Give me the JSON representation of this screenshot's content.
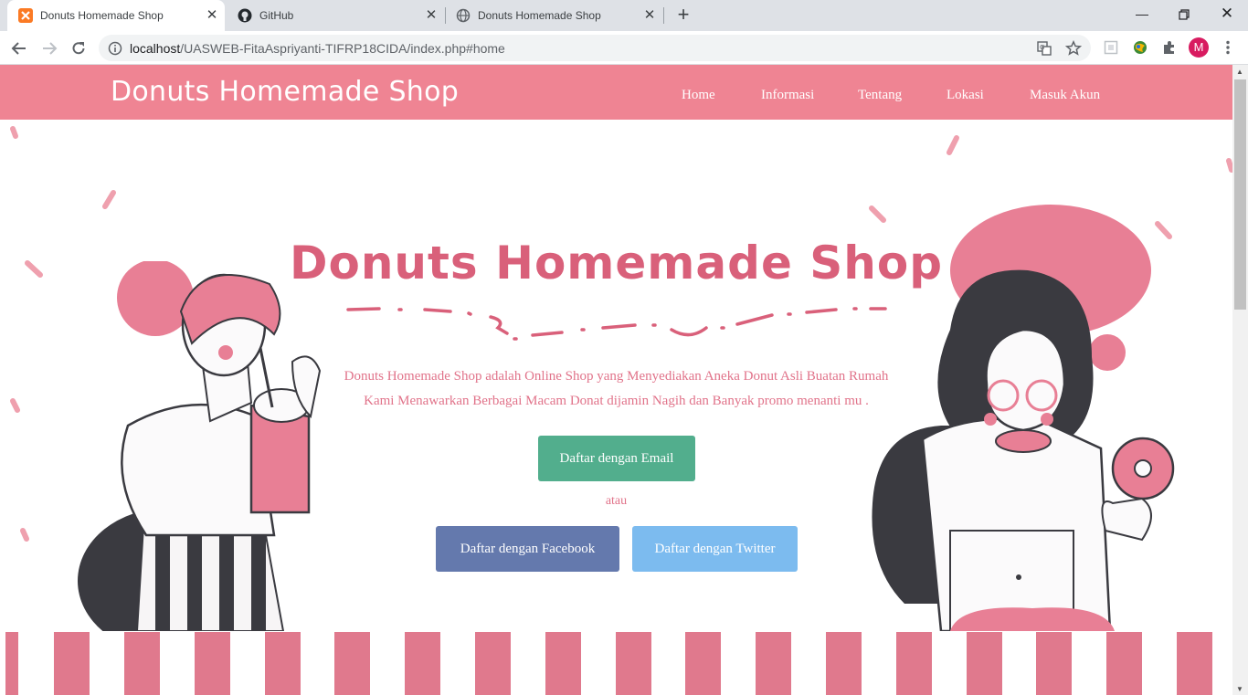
{
  "browser": {
    "tabs": [
      {
        "title": "Donuts Homemade Shop",
        "active": true,
        "icon": "xampp-icon"
      },
      {
        "title": "GitHub",
        "active": false,
        "icon": "github-icon"
      },
      {
        "title": "Donuts Homemade Shop",
        "active": false,
        "icon": "globe-icon"
      }
    ],
    "new_tab": "+",
    "url_host": "localhost",
    "url_path": "/UASWEB-FitaAspriyanti-TIFRP18CIDA/index.php#home",
    "profile_initial": "M",
    "colors": {
      "tabbar": "#dee1e6",
      "profile": "#d81b60"
    }
  },
  "site": {
    "brand": "Donuts Homemade Shop",
    "menu": [
      "Home",
      "Informasi",
      "Tentang",
      "Lokasi",
      "Masuk Akun"
    ],
    "hero": {
      "title": "Donuts Homemade Shop",
      "line1": "Donuts Homemade Shop adalah Online Shop yang Menyediakan Aneka Donut Asli Buatan Rumah",
      "line2": "Kami Menawarkan Berbagai Macam Donat dijamin Nagih dan Banyak promo menanti mu ."
    },
    "buttons": {
      "email": "Daftar dengan Email",
      "or": "atau",
      "facebook": "Daftar dengan Facebook",
      "twitter": "Daftar dengan Twitter"
    },
    "colors": {
      "nav": "#ef8493",
      "title": "#d9607a",
      "email": "#52ae8d",
      "facebook": "#6479ad",
      "twitter": "#7cbbef"
    }
  }
}
